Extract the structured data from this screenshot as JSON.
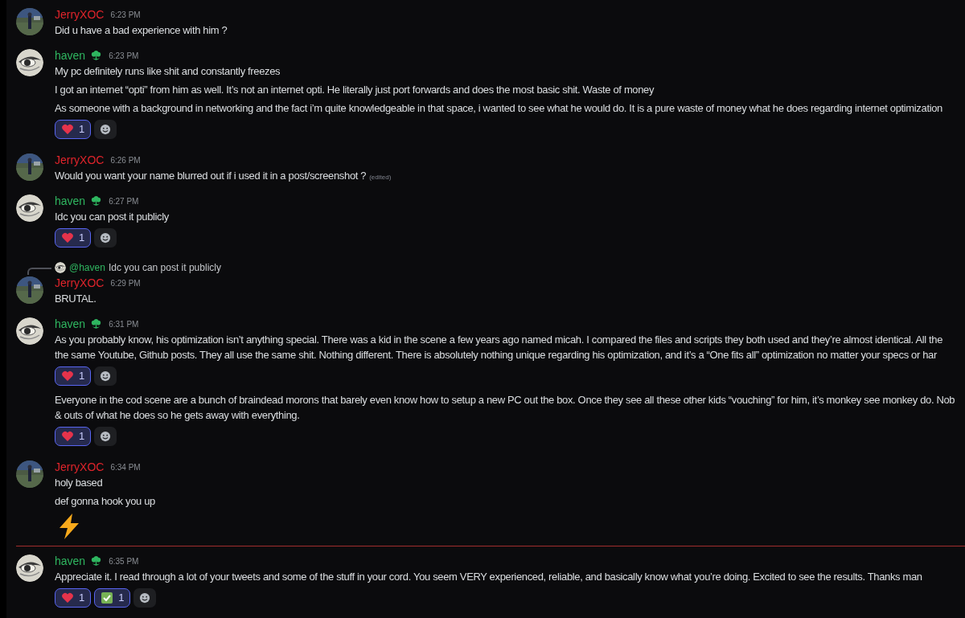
{
  "messages": [
    {
      "author": "JerryXOC",
      "color": "#e0242b",
      "avatar": {
        "kind": "photo"
      },
      "badge": false,
      "time": "6:23 PM",
      "new_divider_before": false,
      "blocks": [
        {
          "kind": "text",
          "lines": [
            "Did u have a bad experience with him ?"
          ]
        }
      ]
    },
    {
      "author": "haven",
      "color": "#2fb660",
      "avatar": {
        "kind": "eye"
      },
      "badge": true,
      "time": "6:23 PM",
      "new_divider_before": false,
      "blocks": [
        {
          "kind": "text",
          "lines": [
            "My pc definitely runs like shit and constantly freezes"
          ]
        },
        {
          "kind": "text",
          "lines": [
            "I got an internet “opti” from him as well. It’s not an internet opti. He literally just port forwards and does the most basic shit. Waste of money"
          ]
        },
        {
          "kind": "text",
          "lines": [
            "As someone with a background in networking and the fact i’m quite knowledgeable in that space, i wanted to see what he would do. It is a pure waste of money what he does regarding internet optimization"
          ]
        },
        {
          "kind": "reactions",
          "items": [
            {
              "kind": "heart",
              "count": "1",
              "selected": true
            }
          ]
        }
      ]
    },
    {
      "author": "JerryXOC",
      "color": "#e0242b",
      "avatar": {
        "kind": "photo"
      },
      "badge": false,
      "time": "6:26 PM",
      "new_divider_before": false,
      "blocks": [
        {
          "kind": "text",
          "lines": [
            "Would you want your name blurred out if i used it in a post/screenshot ?"
          ],
          "edited": "(edited)"
        }
      ]
    },
    {
      "author": "haven",
      "color": "#2fb660",
      "avatar": {
        "kind": "eye"
      },
      "badge": true,
      "time": "6:27 PM",
      "new_divider_before": false,
      "blocks": [
        {
          "kind": "text",
          "lines": [
            "Idc you can post it publicly"
          ]
        },
        {
          "kind": "reactions",
          "items": [
            {
              "kind": "heart",
              "count": "1",
              "selected": true
            }
          ]
        }
      ]
    },
    {
      "author": "JerryXOC",
      "color": "#e0242b",
      "avatar": {
        "kind": "photo"
      },
      "badge": false,
      "time": "6:29 PM",
      "new_divider_before": false,
      "reply": {
        "author": "@haven",
        "text": "Idc you can post it publicly"
      },
      "blocks": [
        {
          "kind": "text",
          "lines": [
            "BRUTAL."
          ]
        }
      ]
    },
    {
      "author": "haven",
      "color": "#2fb660",
      "avatar": {
        "kind": "eye"
      },
      "badge": true,
      "time": "6:31 PM",
      "new_divider_before": false,
      "blocks": [
        {
          "kind": "text",
          "lines": [
            "As you probably know, his optimization isn’t anything special. There was a kid in the scene a few years ago named micah. I compared the files and scripts they both used and they’re almost identical. All the",
            "the same Youtube, Github posts. They all use the same shit. Nothing different. There is absolutely nothing unique regarding his optimization, and it’s a “One fits all” optimization no matter your specs or har"
          ]
        },
        {
          "kind": "reactions",
          "items": [
            {
              "kind": "heart",
              "count": "1",
              "selected": true
            }
          ]
        },
        {
          "kind": "text",
          "lines": [
            "Everyone in the cod scene are a bunch of braindead morons that barely even know how to setup a new PC out the box. Once they see all these other kids “vouching” for him, it’s monkey see monkey do. Nob",
            "& outs of what he does so he gets away with everything."
          ]
        },
        {
          "kind": "reactions",
          "items": [
            {
              "kind": "heart",
              "count": "1",
              "selected": true
            }
          ]
        }
      ]
    },
    {
      "author": "JerryXOC",
      "color": "#e0242b",
      "avatar": {
        "kind": "photo"
      },
      "badge": false,
      "time": "6:34 PM",
      "new_divider_before": false,
      "blocks": [
        {
          "kind": "text",
          "lines": [
            "holy based"
          ]
        },
        {
          "kind": "text",
          "lines": [
            "def gonna hook you up"
          ]
        },
        {
          "kind": "emoji"
        }
      ]
    },
    {
      "author": "haven",
      "color": "#2fb660",
      "avatar": {
        "kind": "eye"
      },
      "badge": true,
      "time": "6:35 PM",
      "new_divider_before": true,
      "blocks": [
        {
          "kind": "text",
          "lines": [
            "Appreciate it. I read through a lot of your tweets and some of the stuff in your cord. You seem VERY experienced, reliable, and basically know what you’re doing. Excited to see the results. Thanks man"
          ]
        },
        {
          "kind": "reactions",
          "items": [
            {
              "kind": "heart",
              "count": "1",
              "selected": true
            },
            {
              "kind": "check",
              "count": "1",
              "selected": true
            }
          ]
        }
      ]
    }
  ]
}
